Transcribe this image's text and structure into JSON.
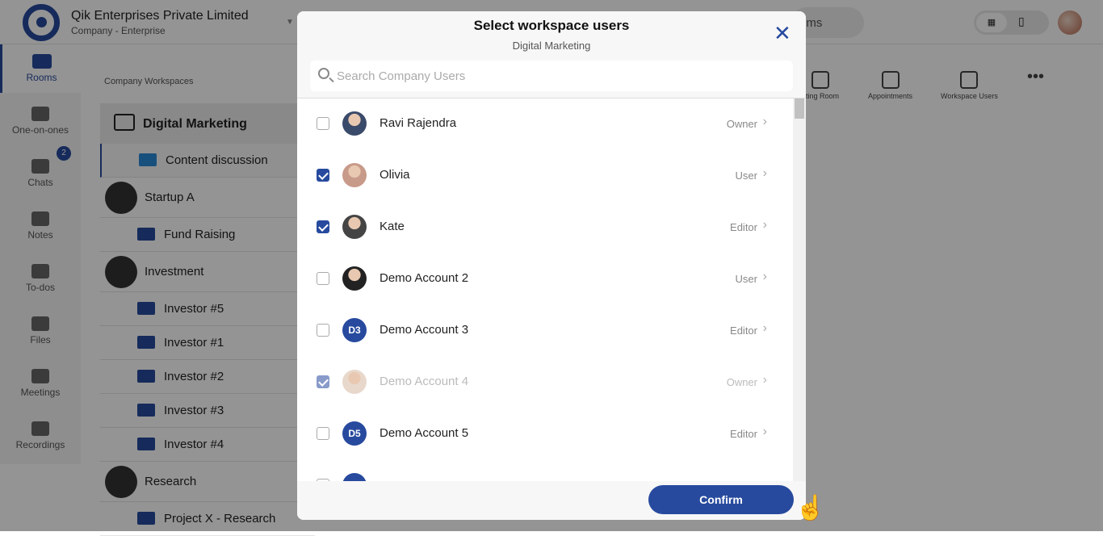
{
  "header": {
    "company": "Qik Enterprises Private Limited",
    "plan": "Company - Enterprise",
    "search_partial": "oms"
  },
  "nav": [
    {
      "label": "Rooms",
      "icon": "rooms-icon",
      "active": true
    },
    {
      "label": "One-on-ones",
      "icon": "people-icon"
    },
    {
      "label": "Chats",
      "icon": "chat-icon",
      "badge": "2"
    },
    {
      "label": "Notes",
      "icon": "notes-icon"
    },
    {
      "label": "To-dos",
      "icon": "todo-icon"
    },
    {
      "label": "Files",
      "icon": "files-icon"
    },
    {
      "label": "Meetings",
      "icon": "meetings-icon"
    },
    {
      "label": "Recordings",
      "icon": "recordings-icon"
    }
  ],
  "workspaces": {
    "label": "Company Workspaces",
    "current": "Digital Marketing",
    "rows": [
      "Content discussion",
      "Startup A",
      "Fund Raising",
      "Investment",
      "Investor #5",
      "Investor #1",
      "Investor #2",
      "Investor #3",
      "Investor #4",
      "Research",
      "Project X - Research"
    ]
  },
  "toolbar": [
    "eting Room",
    "Appointments",
    "Workspace Users"
  ],
  "modal": {
    "title": "Select workspace users",
    "subtitle": "Digital Marketing",
    "search_placeholder": "Search Company Users",
    "confirm": "Confirm",
    "users": [
      {
        "name": "Ravi Rajendra",
        "role": "Owner",
        "checked": false,
        "avatar": "photo"
      },
      {
        "name": "Olivia",
        "role": "User",
        "checked": true,
        "avatar": "photo"
      },
      {
        "name": "Kate",
        "role": "Editor",
        "checked": true,
        "avatar": "photo"
      },
      {
        "name": "Demo Account 2",
        "role": "User",
        "checked": false,
        "avatar": "photo"
      },
      {
        "name": "Demo Account 3",
        "role": "Editor",
        "checked": false,
        "initials": "D3"
      },
      {
        "name": "Demo Account 4",
        "role": "Owner",
        "checked": true,
        "disabled": true,
        "avatar": "photo"
      },
      {
        "name": "Demo Account 5",
        "role": "Editor",
        "checked": false,
        "initials": "D5"
      }
    ]
  },
  "colors": {
    "accent": "#274a9e"
  }
}
